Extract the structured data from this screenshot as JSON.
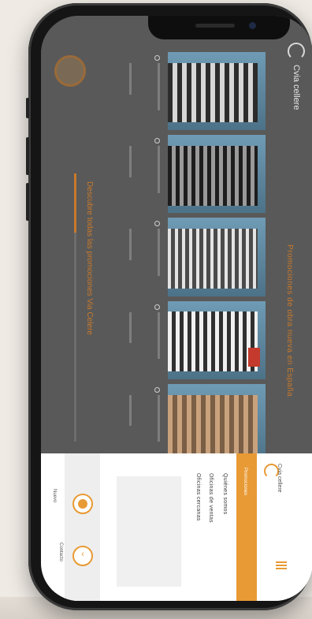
{
  "site": {
    "logo_text": "Cvia cellere"
  },
  "page": {
    "heading": "Promociones de obra nueva en España",
    "link": "Descubre todas las promociones Via Celere"
  },
  "menu": {
    "orange_tab": "Promociones",
    "logo_text": "Cvia cellere",
    "item1": "Quiénes somos",
    "item2": "Oficinas de ventas",
    "item3": "Oficinas cercanas",
    "small_label": "Nuevo",
    "btn_label": "Contacto"
  },
  "colors": {
    "accent": "#e89a34",
    "overlay": "#595959"
  }
}
